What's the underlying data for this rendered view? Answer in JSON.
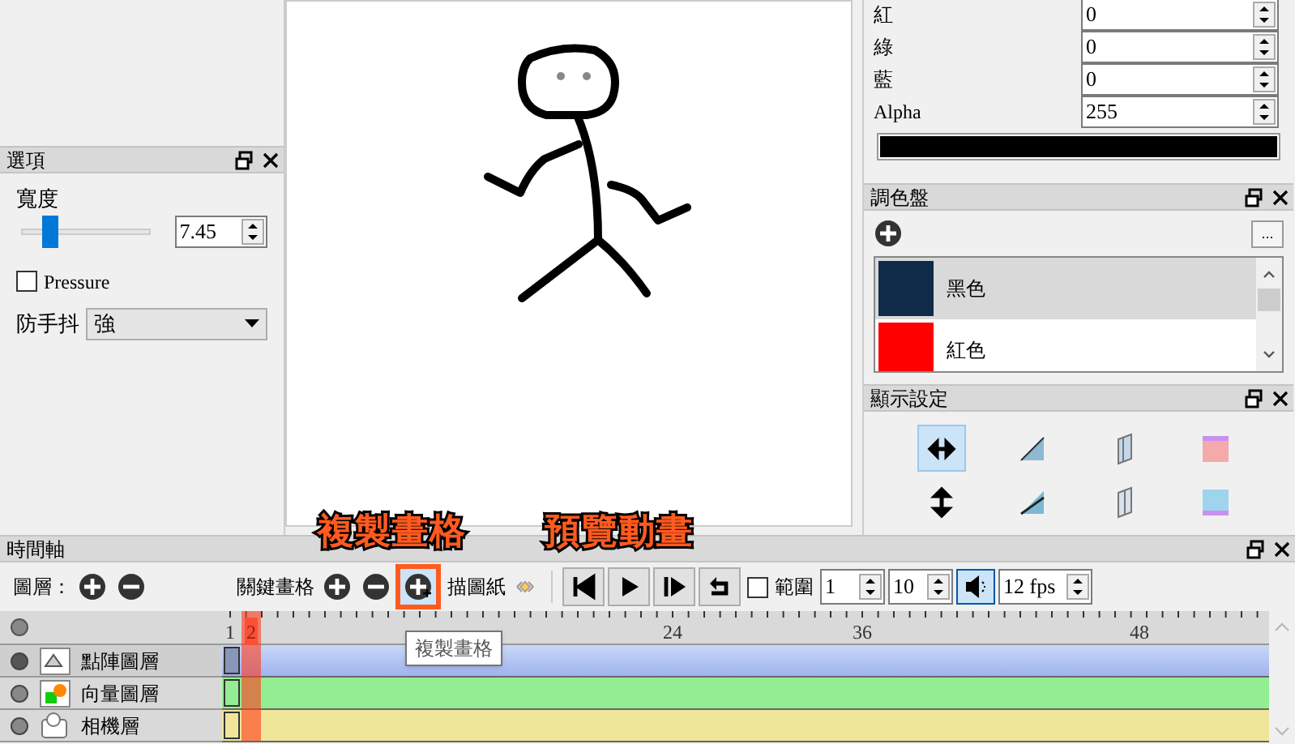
{
  "options_panel": {
    "title": "選項",
    "width_label": "寬度",
    "width_slider": {
      "level": 0.25
    },
    "width_value": "7.45",
    "pressure": {
      "label": "Pressure",
      "checked": false
    },
    "stabilizer": {
      "label": "防手抖",
      "value": "強"
    }
  },
  "color_fields": [
    {
      "label": "紅",
      "value": "0"
    },
    {
      "label": "綠",
      "value": "0"
    },
    {
      "label": "藍",
      "value": "0"
    },
    {
      "label": "Alpha",
      "value": "255"
    }
  ],
  "color_preview": {
    "color": "#000000"
  },
  "palette": {
    "title": "調色盤",
    "more_button": "...",
    "items": [
      {
        "name": "黑色",
        "color": "#102a4a",
        "selected": true
      },
      {
        "name": "紅色",
        "color": "#ff0000",
        "selected": false
      }
    ]
  },
  "display_settings": {
    "title": "顯示設定",
    "items": [
      {
        "kind": "flip-h",
        "selected": true
      },
      {
        "kind": "gradient-a",
        "selected": false
      },
      {
        "kind": "panel-a",
        "selected": false
      },
      {
        "kind": "color-top",
        "selected": false
      },
      {
        "kind": "flip-v",
        "selected": false
      },
      {
        "kind": "gradient-b",
        "selected": false
      },
      {
        "kind": "panel-b",
        "selected": false
      },
      {
        "kind": "color-bottom",
        "selected": false
      }
    ]
  },
  "timeline": {
    "title": "時間軸",
    "layers_label": "圖層：",
    "keyframe_label": "關鍵畫格",
    "onion_label": "描圖紙",
    "range": {
      "label": "範圍",
      "checked": false
    },
    "range_start": "1",
    "range_end": "10",
    "sound": {
      "selected": true
    },
    "fps": "12 fps",
    "ruler": [
      {
        "text": "1",
        "selected": false
      },
      {
        "text": "2",
        "selected": true
      },
      {
        "text": "24",
        "selected": false
      },
      {
        "text": "36",
        "selected": false
      },
      {
        "text": "48",
        "selected": false
      }
    ],
    "layers": [
      {
        "name": "點陣圖層",
        "kind": "bitmap",
        "selected": true
      },
      {
        "name": "向量圖層",
        "kind": "vector",
        "selected": false
      },
      {
        "name": "相機層",
        "kind": "camera",
        "selected": false
      }
    ],
    "tooltip": "複製畫格"
  },
  "annotations": [
    "複製畫格",
    "預覽動畫"
  ]
}
